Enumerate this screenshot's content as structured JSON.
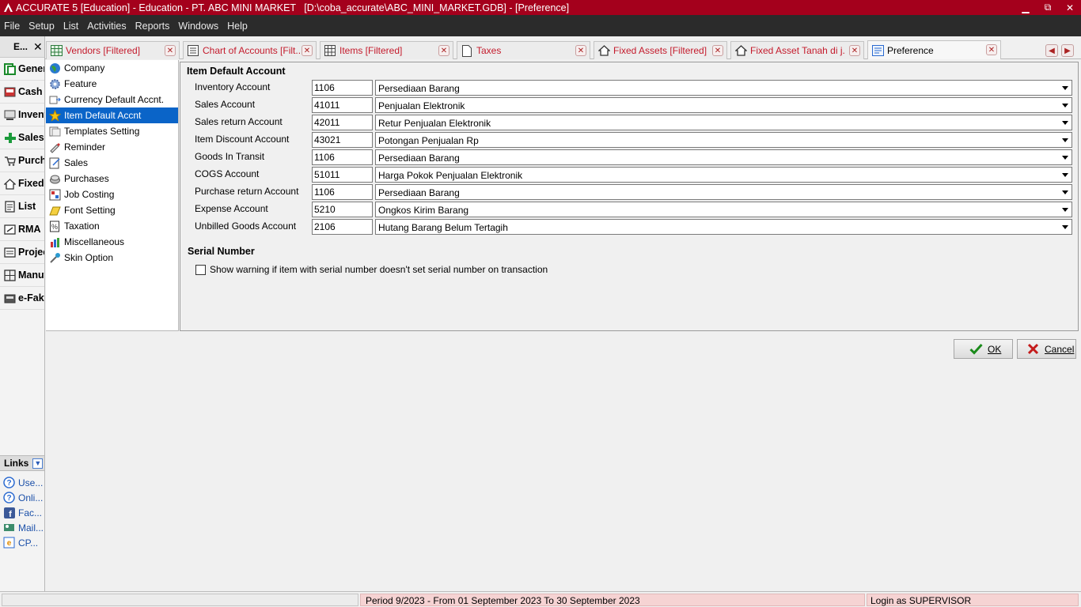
{
  "window": {
    "title": "ACCURATE 5 [Education] - Education - PT. ABC MINI MARKET   [D:\\coba_accurate\\ABC_MINI_MARKET.GDB] - [Preference]",
    "minimize": "▁",
    "restore": "⧉",
    "close": "✕"
  },
  "menu": [
    "File",
    "Setup",
    "List",
    "Activities",
    "Reports",
    "Windows",
    "Help"
  ],
  "leftnav": {
    "header": "E...",
    "close": "✕",
    "items": [
      {
        "label": "General Ledger",
        "icon": "ledger-icon"
      },
      {
        "label": "Cash",
        "icon": "cash-icon"
      },
      {
        "label": "Inventory",
        "icon": "inventory-icon"
      },
      {
        "label": "Sales",
        "icon": "sales-icon"
      },
      {
        "label": "Purchases",
        "icon": "purchase-icon"
      },
      {
        "label": "Fixed Assets",
        "icon": "fixed-asset-icon"
      },
      {
        "label": "List",
        "icon": "list-icon"
      },
      {
        "label": "RMA",
        "icon": "rma-icon"
      },
      {
        "label": "Project",
        "icon": "project-icon"
      },
      {
        "label": "Manufacture",
        "icon": "manufacture-icon"
      },
      {
        "label": "e-Faktur",
        "icon": "efaktur-icon"
      }
    ],
    "links_header": "Links",
    "links": [
      {
        "label": "Use...",
        "icon": "help-icon"
      },
      {
        "label": "Onli...",
        "icon": "help-icon"
      },
      {
        "label": "Fac...",
        "icon": "facebook-icon"
      },
      {
        "label": "Mail...",
        "icon": "mail-icon"
      },
      {
        "label": "CP...",
        "icon": "cpe-icon"
      }
    ]
  },
  "tabs": [
    {
      "label": "Vendors [Filtered]",
      "icon": "table-icon",
      "active": false
    },
    {
      "label": "Chart of Accounts [Filt...",
      "icon": "coa-icon",
      "active": false
    },
    {
      "label": "Items [Filtered]",
      "icon": "grid-icon",
      "active": false
    },
    {
      "label": "Taxes",
      "icon": "document-icon",
      "active": false
    },
    {
      "label": "Fixed Assets [Filtered]",
      "icon": "house-icon",
      "active": false
    },
    {
      "label": "Fixed Asset Tanah di j...",
      "icon": "house-icon",
      "active": false
    },
    {
      "label": "Preference",
      "icon": "preference-icon",
      "active": true
    }
  ],
  "tab_close": "✕",
  "tree": [
    {
      "label": "Company",
      "icon": "globe-icon"
    },
    {
      "label": "Feature",
      "icon": "gear-icon"
    },
    {
      "label": "Currency Default Accnt.",
      "icon": "currency-icon"
    },
    {
      "label": "Item Default Accnt",
      "icon": "star-icon",
      "selected": true
    },
    {
      "label": "Templates Setting",
      "icon": "templates-icon"
    },
    {
      "label": "Reminder",
      "icon": "reminder-icon"
    },
    {
      "label": "Sales",
      "icon": "sales-doc-icon"
    },
    {
      "label": "Purchases",
      "icon": "purchases-icon"
    },
    {
      "label": "Job Costing",
      "icon": "job-costing-icon"
    },
    {
      "label": "Font Setting",
      "icon": "font-icon"
    },
    {
      "label": "Taxation",
      "icon": "taxation-icon"
    },
    {
      "label": "Miscellaneous",
      "icon": "misc-icon"
    },
    {
      "label": "Skin Option",
      "icon": "skin-icon"
    }
  ],
  "item_default": {
    "title": "Item Default Account",
    "rows": [
      {
        "label": "Inventory Account",
        "code": "1106",
        "name": "Persediaan Barang"
      },
      {
        "label": "Sales Account",
        "code": "41011",
        "name": "Penjualan Elektronik"
      },
      {
        "label": "Sales return Account",
        "code": "42011",
        "name": "Retur Penjualan Elektronik"
      },
      {
        "label": "Item Discount Account",
        "code": "43021",
        "name": "Potongan Penjualan Rp"
      },
      {
        "label": "Goods In Transit",
        "code": "1106",
        "name": "Persediaan Barang"
      },
      {
        "label": "COGS Account",
        "code": "51011",
        "name": "Harga Pokok Penjualan Elektronik"
      },
      {
        "label": "Purchase return Account",
        "code": "1106",
        "name": "Persediaan Barang"
      },
      {
        "label": "Expense Account",
        "code": "5210",
        "name": "Ongkos Kirim Barang"
      },
      {
        "label": "Unbilled Goods Account",
        "code": "2106",
        "name": "Hutang Barang Belum Tertagih"
      }
    ]
  },
  "serial": {
    "title": "Serial Number",
    "checkbox_label": "Show warning if item with serial number doesn't set serial number on transaction",
    "checked": false
  },
  "buttons": {
    "ok": "OK",
    "cancel": "Cancel"
  },
  "status": {
    "period": "Period 9/2023 - From 01 September 2023 To 30 September 2023",
    "login": "Login as SUPERVISOR"
  },
  "colors": {
    "titlebar": "#a4001c",
    "menubar": "#2b2b2b",
    "selection": "#0a64c8",
    "tab_text": "#c41b2c",
    "status_bg": "#f6d3d3"
  }
}
